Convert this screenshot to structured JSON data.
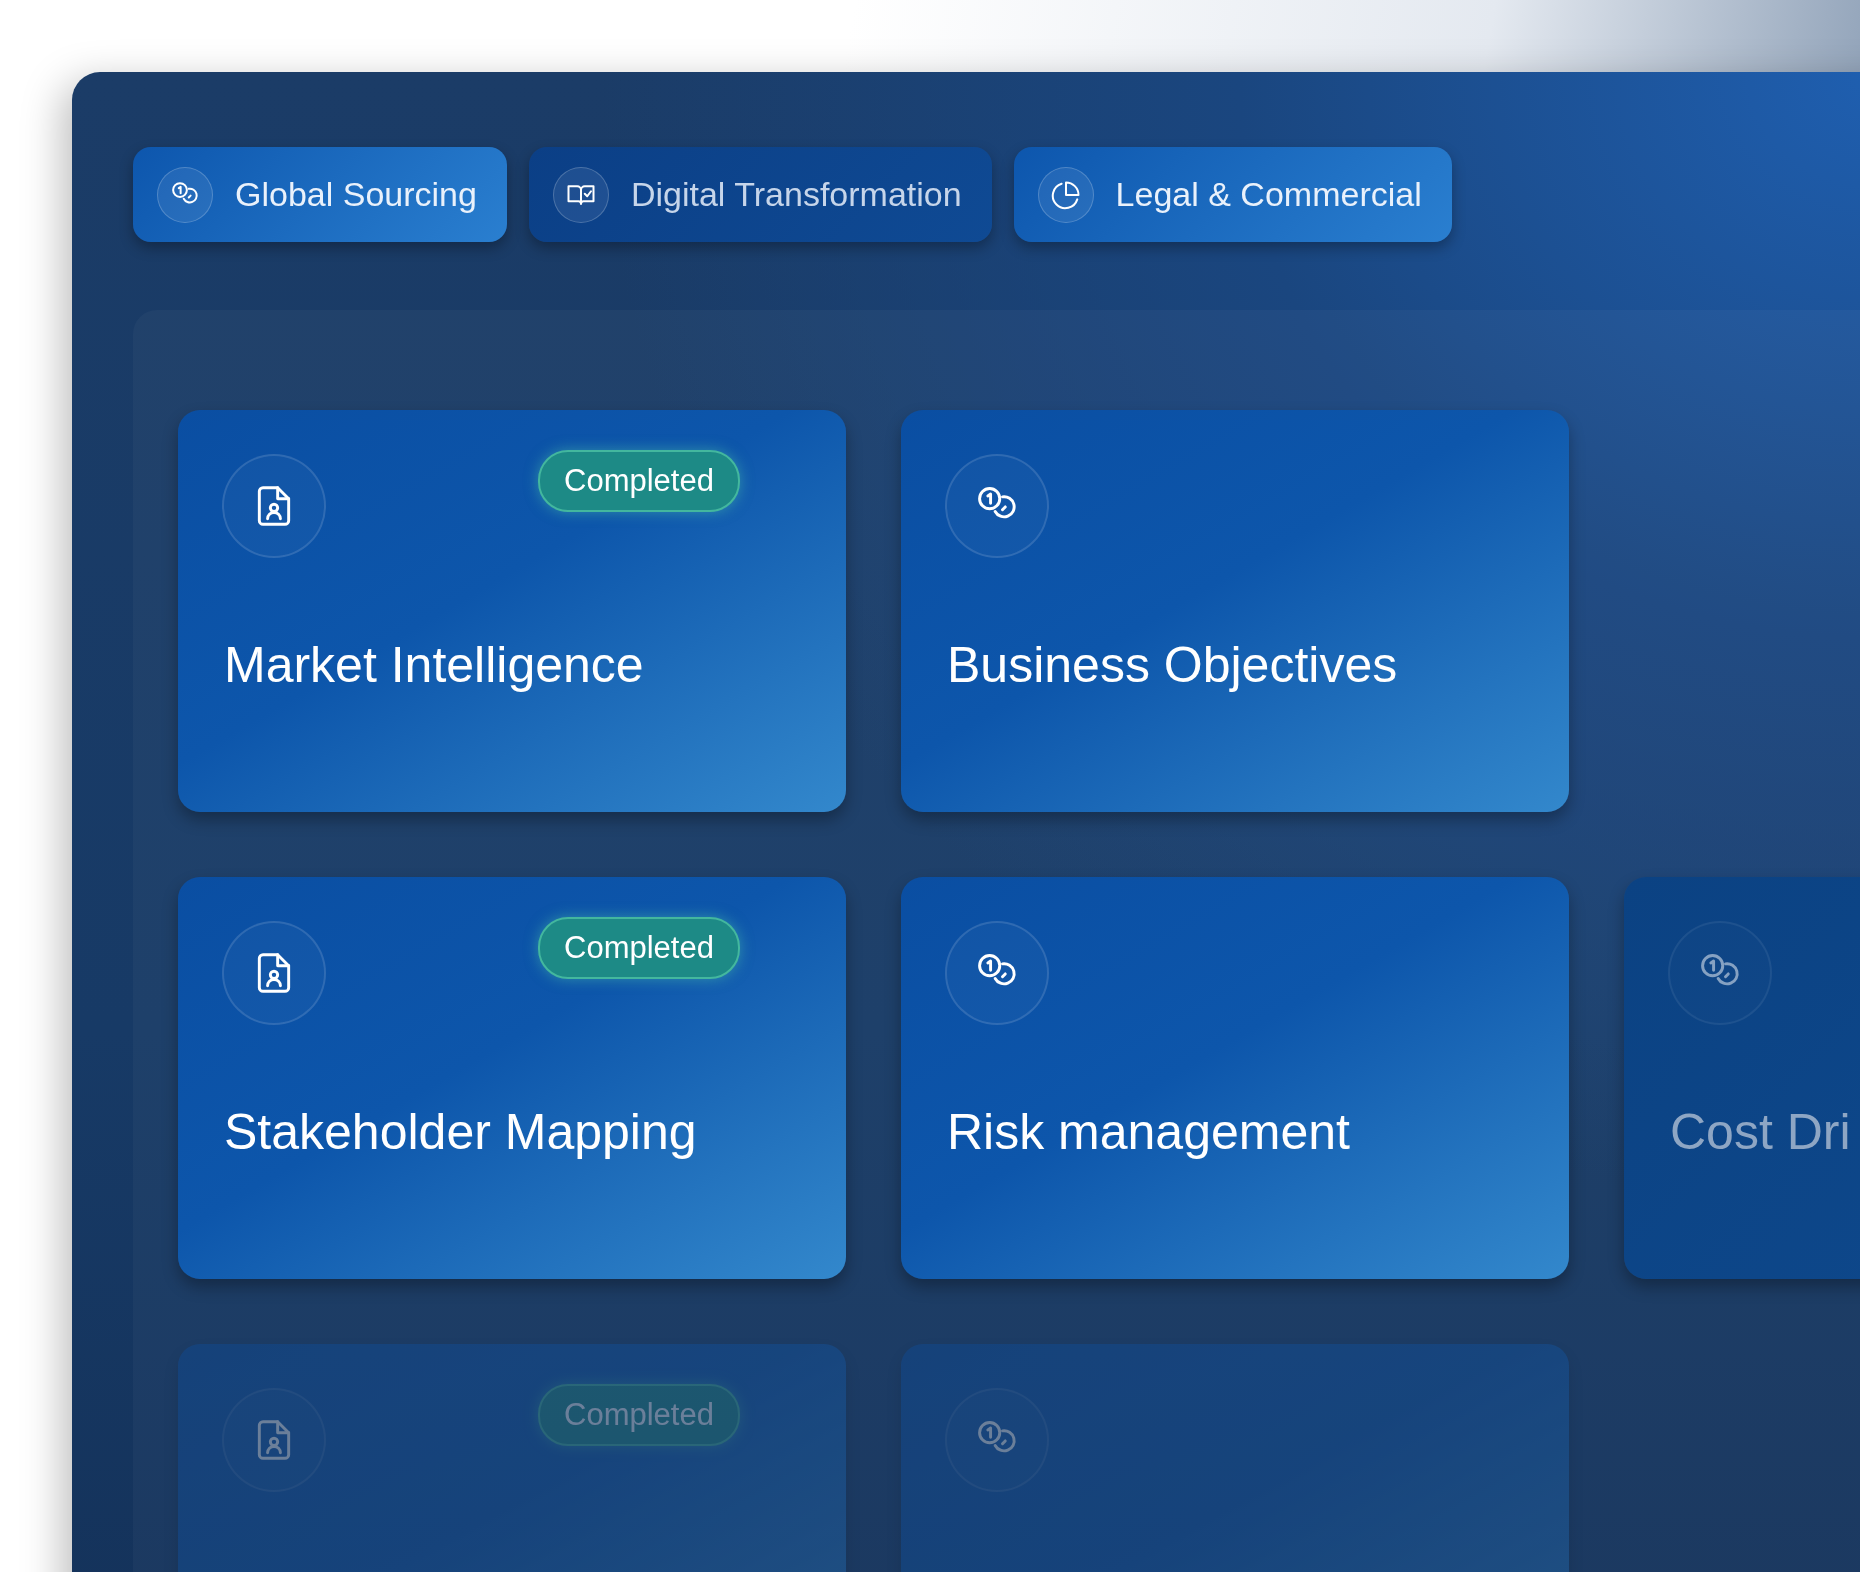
{
  "tabs": [
    {
      "label": "Global Sourcing",
      "kind": "coins",
      "selected": true
    },
    {
      "label": "Digital Transformation",
      "kind": "book",
      "selected": false
    },
    {
      "label": "Legal & Commercial",
      "kind": "pie",
      "selected": true
    }
  ],
  "rows": [
    {
      "faded": false,
      "cards": [
        {
          "title": "Market Intelligence",
          "kind": "document",
          "badge": "Completed",
          "faded": false
        },
        {
          "title": "Business Objectives",
          "kind": "coins",
          "faded": false
        }
      ]
    },
    {
      "faded": false,
      "cards": [
        {
          "title": "Stakeholder Mapping",
          "kind": "document",
          "badge": "Completed",
          "faded": false
        },
        {
          "title": "Risk management",
          "kind": "coins",
          "faded": false
        },
        {
          "title": "Cost Dri",
          "kind": "coins",
          "faded": true
        }
      ]
    },
    {
      "faded": true,
      "cards": [
        {
          "kind": "document",
          "badge": "Completed",
          "faded": false
        },
        {
          "kind": "coins",
          "faded": false
        }
      ]
    }
  ]
}
